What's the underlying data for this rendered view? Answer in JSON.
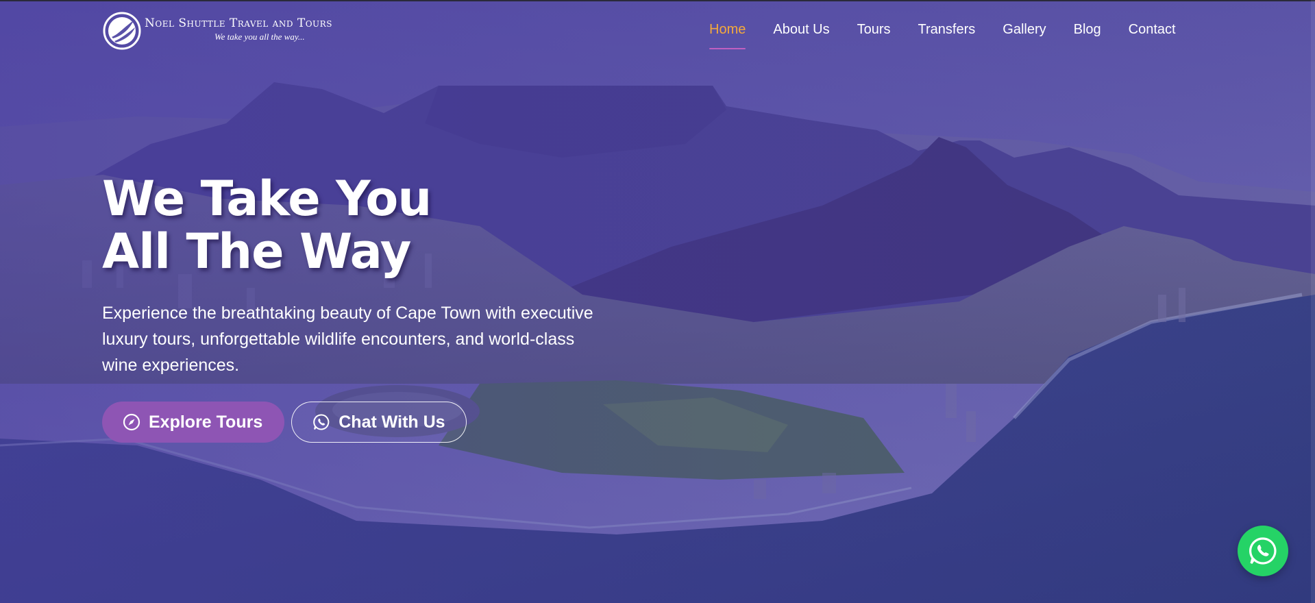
{
  "brand": {
    "name": "Noel Shuttle Travel and Tours",
    "tagline": "We take you all the way..."
  },
  "nav": {
    "items": [
      {
        "label": "Home",
        "active": true
      },
      {
        "label": "About Us",
        "active": false
      },
      {
        "label": "Tours",
        "active": false
      },
      {
        "label": "Transfers",
        "active": false
      },
      {
        "label": "Gallery",
        "active": false
      },
      {
        "label": "Blog",
        "active": false
      },
      {
        "label": "Contact",
        "active": false
      }
    ]
  },
  "hero": {
    "headline_line1": "We Take You",
    "headline_line2": "All The Way",
    "lead": "Experience the breathtaking beauty of Cape Town with executive luxury tours, unforgettable wildlife encounters, and world-class wine experiences.",
    "primary_button": {
      "label": "Explore Tours",
      "icon": "compass-icon"
    },
    "secondary_button": {
      "label": "Chat With Us",
      "icon": "whatsapp-icon"
    }
  },
  "floating": {
    "icon": "whatsapp-icon"
  },
  "colors": {
    "overlay": "#483aa0",
    "nav_active": "#f4a93c",
    "nav_underline": "#c060c0",
    "primary_button": "#8e55b4",
    "whatsapp": "#25d366"
  }
}
